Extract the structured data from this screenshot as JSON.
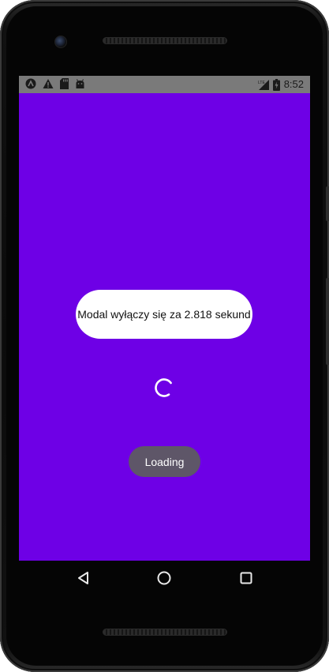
{
  "status_bar": {
    "time": "8:52",
    "left_icons": [
      "app-a-icon",
      "warning-icon",
      "sd-card-icon",
      "android-icon"
    ],
    "right_icons": [
      "signal-lte-icon",
      "battery-charging-icon"
    ],
    "background": "#7a7a7a"
  },
  "screen": {
    "background": "#6e00e6"
  },
  "toast": {
    "message": "Modal wyłączy się za 2.818 sekund"
  },
  "loading": {
    "label": "Loading"
  },
  "nav_bar": {
    "buttons": [
      "back-icon",
      "home-icon",
      "recents-icon"
    ]
  }
}
